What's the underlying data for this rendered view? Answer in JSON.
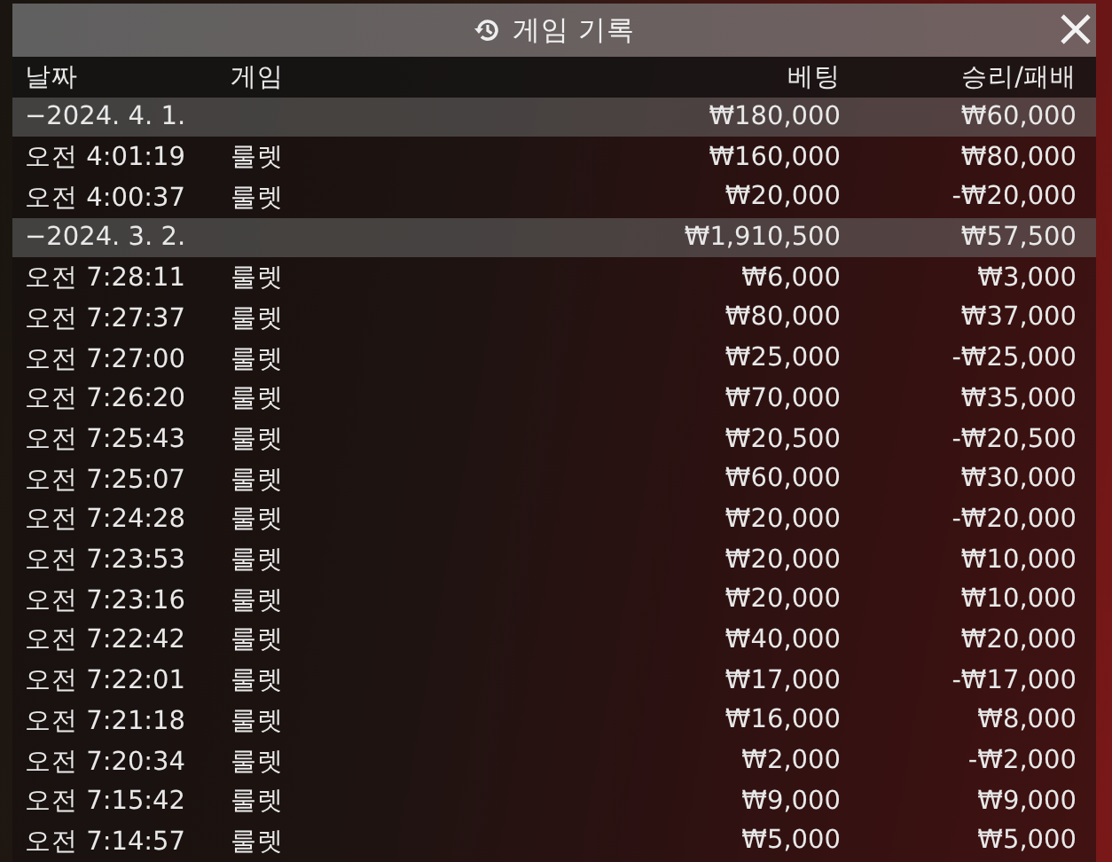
{
  "window": {
    "title": "게임 기록"
  },
  "columns": [
    "날짜",
    "게임",
    "베팅",
    "승리/패배"
  ],
  "groups": [
    {
      "date": "−2024. 4. 1.",
      "bet": "₩180,000",
      "result": "₩60,000",
      "rows": [
        {
          "time": "오전 4:01:19",
          "game": "룰렛",
          "bet": "₩160,000",
          "result": "₩80,000"
        },
        {
          "time": "오전 4:00:37",
          "game": "룰렛",
          "bet": "₩20,000",
          "result": "-₩20,000"
        }
      ]
    },
    {
      "date": "−2024. 3. 2.",
      "bet": "₩1,910,500",
      "result": "₩57,500",
      "rows": [
        {
          "time": "오전 7:28:11",
          "game": "룰렛",
          "bet": "₩6,000",
          "result": "₩3,000"
        },
        {
          "time": "오전 7:27:37",
          "game": "룰렛",
          "bet": "₩80,000",
          "result": "₩37,000"
        },
        {
          "time": "오전 7:27:00",
          "game": "룰렛",
          "bet": "₩25,000",
          "result": "-₩25,000"
        },
        {
          "time": "오전 7:26:20",
          "game": "룰렛",
          "bet": "₩70,000",
          "result": "₩35,000"
        },
        {
          "time": "오전 7:25:43",
          "game": "룰렛",
          "bet": "₩20,500",
          "result": "-₩20,500"
        },
        {
          "time": "오전 7:25:07",
          "game": "룰렛",
          "bet": "₩60,000",
          "result": "₩30,000"
        },
        {
          "time": "오전 7:24:28",
          "game": "룰렛",
          "bet": "₩20,000",
          "result": "-₩20,000"
        },
        {
          "time": "오전 7:23:53",
          "game": "룰렛",
          "bet": "₩20,000",
          "result": "₩10,000"
        },
        {
          "time": "오전 7:23:16",
          "game": "룰렛",
          "bet": "₩20,000",
          "result": "₩10,000"
        },
        {
          "time": "오전 7:22:42",
          "game": "룰렛",
          "bet": "₩40,000",
          "result": "₩20,000"
        },
        {
          "time": "오전 7:22:01",
          "game": "룰렛",
          "bet": "₩17,000",
          "result": "-₩17,000"
        },
        {
          "time": "오전 7:21:18",
          "game": "룰렛",
          "bet": "₩16,000",
          "result": "₩8,000"
        },
        {
          "time": "오전 7:20:34",
          "game": "룰렛",
          "bet": "₩2,000",
          "result": "-₩2,000"
        },
        {
          "time": "오전 7:15:42",
          "game": "룰렛",
          "bet": "₩9,000",
          "result": "₩9,000"
        },
        {
          "time": "오전 7:14:57",
          "game": "룰렛",
          "bet": "₩5,000",
          "result": "₩5,000"
        }
      ]
    }
  ]
}
